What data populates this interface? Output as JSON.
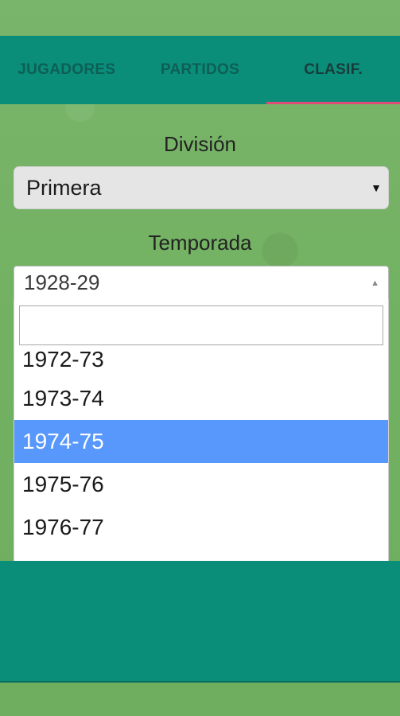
{
  "tabs": [
    {
      "label": "JUGADORES",
      "active": false
    },
    {
      "label": "PARTIDOS",
      "active": false
    },
    {
      "label": "CLASIF.",
      "active": true
    }
  ],
  "division": {
    "label": "División",
    "selected": "Primera"
  },
  "season": {
    "label": "Temporada",
    "selected": "1928-29",
    "search_value": "",
    "options": [
      "1972-73",
      "1973-74",
      "1974-75",
      "1975-76",
      "1976-77"
    ],
    "highlighted_option": "1974-75"
  },
  "colors": {
    "teal": "#0a8e7a",
    "active_indicator": "#e04a74",
    "highlight": "#5897fb",
    "grass": "#73b162"
  }
}
